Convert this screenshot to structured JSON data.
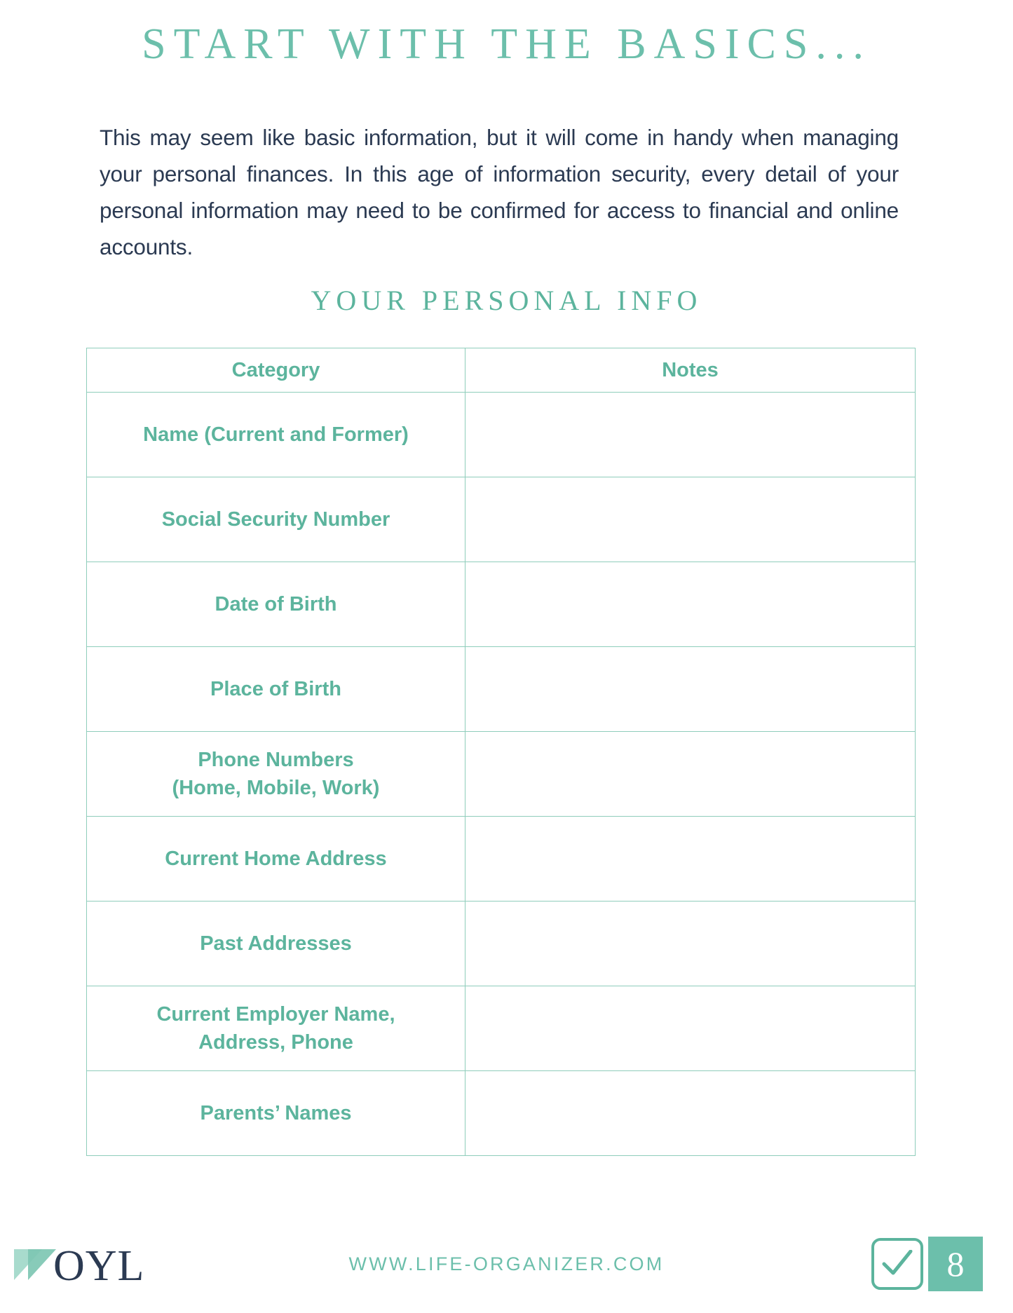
{
  "document": {
    "title": "START WITH THE BASICS...",
    "intro_paragraph": "This may seem like basic information, but it will come in handy when managing your personal finances. In this age of information security, every detail of your personal information may need to be confirmed for access to financial and online accounts.",
    "section_heading": "YOUR PERSONAL INFO"
  },
  "table": {
    "headers": {
      "category": "Category",
      "notes": "Notes"
    },
    "rows": [
      {
        "category_line1": "Name (Current and Former)",
        "category_line2": "",
        "notes": ""
      },
      {
        "category_line1": "Social Security Number",
        "category_line2": "",
        "notes": ""
      },
      {
        "category_line1": "Date of Birth",
        "category_line2": "",
        "notes": ""
      },
      {
        "category_line1": "Place of Birth",
        "category_line2": "",
        "notes": ""
      },
      {
        "category_line1": "Phone Numbers",
        "category_line2": "(Home, Mobile, Work)",
        "notes": ""
      },
      {
        "category_line1": "Current Home Address",
        "category_line2": "",
        "notes": ""
      },
      {
        "category_line1": "Past Addresses",
        "category_line2": "",
        "notes": ""
      },
      {
        "category_line1": "Current Employer Name,",
        "category_line2": "Address, Phone",
        "notes": ""
      },
      {
        "category_line1": "Parents’ Names",
        "category_line2": "",
        "notes": ""
      }
    ]
  },
  "footer": {
    "logo_text": "OYL",
    "logo_mark_icon": "chevron-triangles-icon",
    "url": "WWW.LIFE-ORGANIZER.COM",
    "checkbox_icon": "checkmark-icon",
    "page_number": "8"
  },
  "colors": {
    "accent_green": "#6cbfab",
    "table_green": "#5cb49d",
    "border_green": "#8fcdbb",
    "text_navy": "#2b3a52",
    "logo_mark_light": "#a8dbcd",
    "logo_mark_mid": "#7ec7b3"
  }
}
